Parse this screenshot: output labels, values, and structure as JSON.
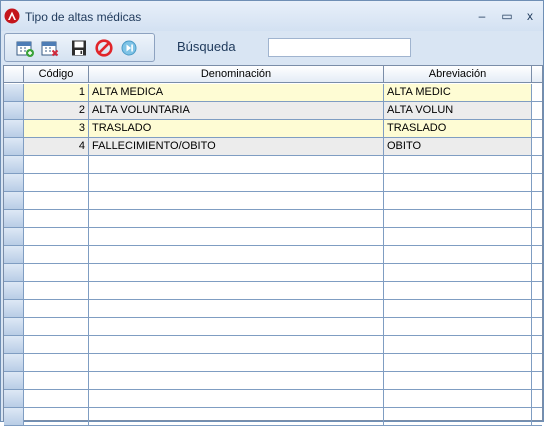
{
  "window": {
    "title": "Tipo de altas médicas",
    "controls": {
      "minimize": "‒",
      "maximize": "▭",
      "close": "x"
    }
  },
  "toolbar": {
    "buttons": [
      {
        "icon": "calendar-add-icon"
      },
      {
        "icon": "calendar-delete-icon"
      },
      {
        "icon": "save-icon"
      },
      {
        "icon": "cancel-icon"
      },
      {
        "icon": "skip-next-icon"
      }
    ]
  },
  "search": {
    "label": "Búsqueda",
    "value": ""
  },
  "grid": {
    "columns": [
      "Código",
      "Denominación",
      "Abreviación"
    ],
    "rows": [
      {
        "codigo": "1",
        "denominacion": "ALTA MEDICA",
        "abreviacion": "ALTA MEDIC"
      },
      {
        "codigo": "2",
        "denominacion": "ALTA VOLUNTARIA",
        "abreviacion": "ALTA VOLUN"
      },
      {
        "codigo": "3",
        "denominacion": "TRASLADO",
        "abreviacion": "TRASLADO"
      },
      {
        "codigo": "4",
        "denominacion": "FALLECIMIENTO/OBITO",
        "abreviacion": "OBITO"
      }
    ],
    "empty_rows": 15
  },
  "colors": {
    "row_odd": "#fefcd4",
    "row_even": "#ececec",
    "accent": "#1e395b"
  }
}
